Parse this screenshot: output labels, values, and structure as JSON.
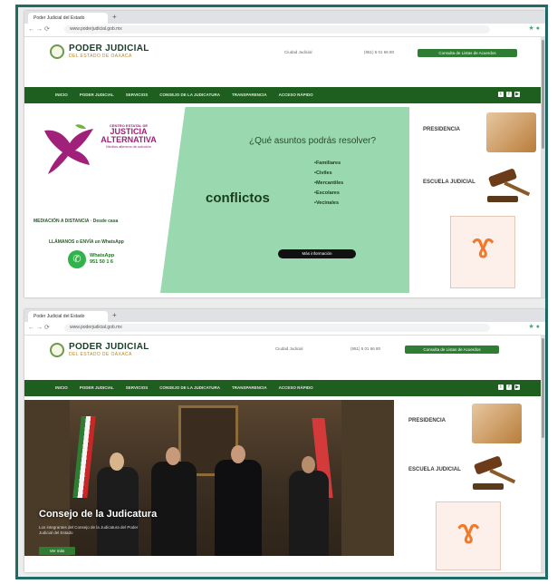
{
  "windows": [
    {
      "tab": "Poder Judicial del Estado",
      "url": "www.poderjudicial.gob.mx",
      "site": {
        "logo_main": "PODER JUDICIAL",
        "logo_sub": "DEL ESTADO DE OAXACA",
        "contact_left": "Ciudad Judicial",
        "contact_right": "(951) 5 01 66 80",
        "cta": "Consulta de Listas de Acuerdos"
      },
      "nav": [
        "INICIO",
        "PODER JUDICIAL",
        "SERVICIOS",
        "CONSEJO DE LA JUDICATURA",
        "TRANSPARENCIA",
        "ACCESO RÁPIDO"
      ],
      "banner": {
        "cj_small": "CENTRO ESTATAL DE",
        "cj_big1": "JUSTICIA",
        "cj_big2": "ALTERNATIVA",
        "cj_sub": "Medios alternos de solución",
        "question": "¿Qué asuntos podrás resolver?",
        "big_word": "conflictos",
        "topics": [
          "Familiares",
          "Civiles",
          "Mercantiles",
          "Escolares",
          "Vecinales"
        ],
        "mediacion": "MEDIACIÓN A DISTANCIA · Desde casa",
        "llamanos": "LLÁMANOS o ENVÍA un WhatsApp",
        "wa_label": "WhatsApp",
        "wa_number": "951 50 1 6",
        "cta": "Más información"
      },
      "side": {
        "card1": "PRESIDENCIA",
        "card2": "ESCUELA JUDICIAL"
      }
    },
    {
      "tab": "Poder Judicial del Estado",
      "url": "www.poderjudicial.gob.mx",
      "site": {
        "logo_main": "PODER JUDICIAL",
        "logo_sub": "DEL ESTADO DE OAXACA",
        "contact_left": "Ciudad Judicial",
        "contact_right": "(951) 5 01 66 80",
        "cta": "Consulta de Listas de Acuerdos"
      },
      "nav": [
        "INICIO",
        "PODER JUDICIAL",
        "SERVICIOS",
        "CONSEJO DE LA JUDICATURA",
        "TRANSPARENCIA",
        "ACCESO RÁPIDO"
      ],
      "hero": {
        "title_plain": "Consejo ",
        "title_bold": "de la Judicatura",
        "caption": "Los integrantes del Consejo de la Judicatura del Poder Judicial del Estado",
        "button": "Ver más"
      },
      "side": {
        "card1": "PRESIDENCIA",
        "card2": "ESCUELA JUDICIAL"
      }
    }
  ],
  "colors": {
    "nav_green": "#1e5e1e",
    "frame_teal": "#1f6b66",
    "panel_green": "#9ad9b0",
    "purple": "#a0207a",
    "ribbon_orange": "#f07a2a"
  }
}
